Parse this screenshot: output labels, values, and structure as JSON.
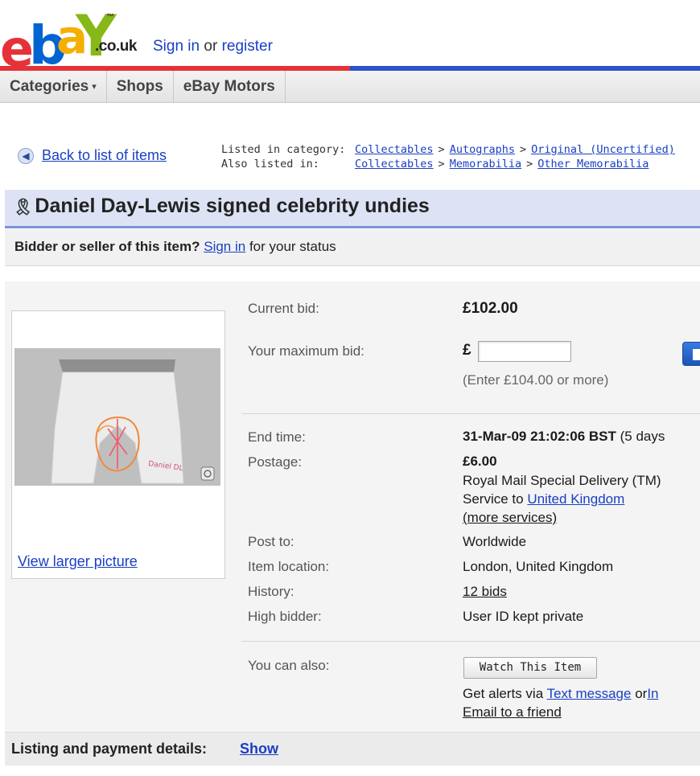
{
  "header": {
    "logo": {
      "e": "e",
      "b": "b",
      "a": "a",
      "y": "Y",
      "tm": "™"
    },
    "domain": ".co.uk",
    "sign_in": "Sign in",
    "or_text": "or",
    "register": "register",
    "bar_colors": [
      "#e53238",
      "#e53238",
      "#2a54c8",
      "#2a54c8"
    ]
  },
  "nav": {
    "tabs": [
      {
        "label": "Categories",
        "has_dropdown": true
      },
      {
        "label": "Shops"
      },
      {
        "label": "eBay Motors"
      }
    ],
    "dropdown_glyph": "▾"
  },
  "breadcrumb": {
    "back_label": "Back to list of items",
    "listed_label": "Listed in category:",
    "listed_path": [
      "Collectables",
      "Autographs",
      "Original (Uncertified)"
    ],
    "also_label": "Also listed in:",
    "also_path": [
      "Collectables",
      "Memorabilia",
      "Other Memorabilia"
    ],
    "separator": ">"
  },
  "item": {
    "title": "Daniel Day-Lewis signed celebrity undies",
    "status_bold": "Bidder or seller of this item?",
    "status_link": "Sign in",
    "status_rest": "for your status",
    "view_larger": "View larger picture",
    "current_bid_label": "Current bid:",
    "current_bid_value": "£102.00",
    "max_bid_label": "Your maximum bid:",
    "currency_symbol": "£",
    "max_bid_input_value": "",
    "enter_hint": "(Enter £104.00 or more)",
    "end_time_label": "End time:",
    "end_time_value": "31-Mar-09 21:02:06 BST",
    "end_time_remaining": "(5 days",
    "postage_label": "Postage:",
    "postage_price": "£6.00",
    "postage_service": "Royal Mail Special Delivery (TM)",
    "service_to_text": "Service to",
    "service_to_link": "United Kingdom",
    "more_services": "(more services)",
    "post_to_label": "Post to:",
    "post_to_value": "Worldwide",
    "location_label": "Item location:",
    "location_value": "London, United Kingdom",
    "history_label": "History:",
    "history_value": "12 bids",
    "high_bidder_label": "High bidder:",
    "high_bidder_value": "User ID kept private",
    "you_can_also_label": "You can also:",
    "watch_button": "Watch This Item",
    "alerts_text": "Get alerts via",
    "alerts_link": "Text message",
    "alerts_or": "or",
    "alerts_link2": "In",
    "email_friend": "Email to a friend",
    "photo_signature": "Daniel DL",
    "listing_label": "Listing and payment details:",
    "show_link": "Show"
  }
}
